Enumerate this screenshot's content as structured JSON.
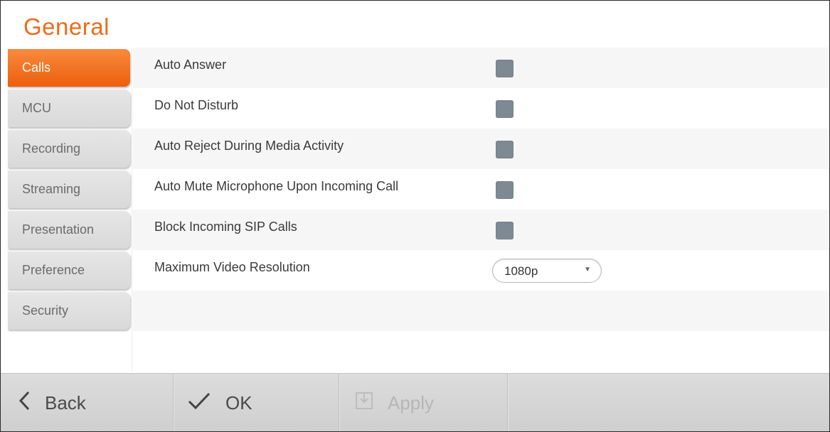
{
  "page": {
    "title": "General"
  },
  "sidebar": {
    "items": [
      {
        "label": "Calls",
        "active": true
      },
      {
        "label": "MCU",
        "active": false
      },
      {
        "label": "Recording",
        "active": false
      },
      {
        "label": "Streaming",
        "active": false
      },
      {
        "label": "Presentation",
        "active": false
      },
      {
        "label": "Preference",
        "active": false
      },
      {
        "label": "Security",
        "active": false
      }
    ]
  },
  "settings": {
    "auto_answer": {
      "label": "Auto Answer",
      "checked": false
    },
    "do_not_disturb": {
      "label": "Do Not Disturb",
      "checked": false
    },
    "auto_reject": {
      "label": "Auto Reject During Media Activity",
      "checked": false
    },
    "auto_mute": {
      "label": "Auto Mute Microphone Upon Incoming Call",
      "checked": false
    },
    "block_sip": {
      "label": "Block Incoming SIP Calls",
      "checked": false
    },
    "max_video_resolution": {
      "label": "Maximum Video Resolution",
      "value": "1080p"
    }
  },
  "toolbar": {
    "back_label": "Back",
    "ok_label": "OK",
    "apply_label": "Apply",
    "apply_enabled": false
  },
  "colors": {
    "accent": "#f06a1a",
    "checkbox": "#7e8a93"
  }
}
